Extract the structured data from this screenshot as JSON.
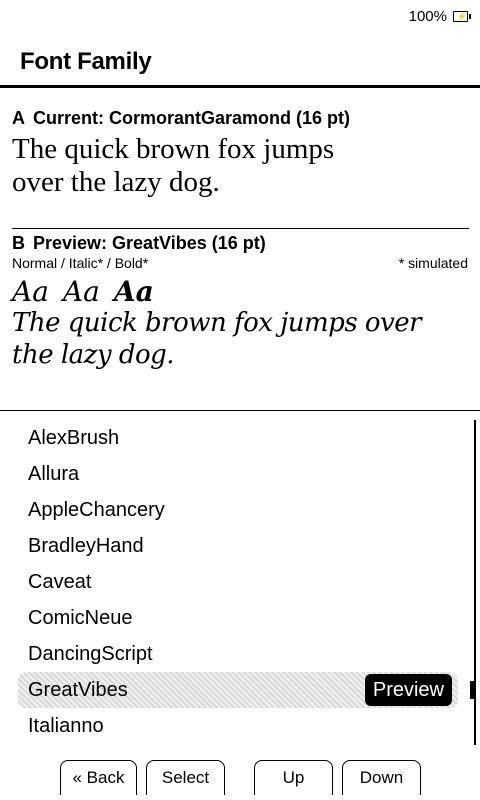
{
  "status": {
    "battery_text": "100%",
    "battery_icon": "battery-charging-icon"
  },
  "header": {
    "title": "Font Family"
  },
  "current": {
    "letter": "A",
    "label": "Current: CormorantGaramond (16 pt)",
    "sample_line1": "The quick brown fox jumps",
    "sample_line2": "over the lazy dog."
  },
  "preview": {
    "letter": "B",
    "label": "Preview: GreatVibes (16 pt)",
    "styles_label": "Normal / Italic* / Bold*",
    "simulated_note": "* simulated",
    "style_normal": "Aa",
    "style_italic": "Aa",
    "style_bold": "Aa",
    "sample_line1": "The quick brown fox jumps over",
    "sample_line2": "the lazy dog."
  },
  "font_list": {
    "items": [
      "AlexBrush",
      "Allura",
      "AppleChancery",
      "BradleyHand",
      "Caveat",
      "ComicNeue",
      "DancingScript",
      "GreatVibes",
      "Italianno"
    ],
    "selected_index": 7,
    "preview_button": "Preview"
  },
  "footer": {
    "back": "« Back",
    "select": "Select",
    "up": "Up",
    "down": "Down"
  }
}
